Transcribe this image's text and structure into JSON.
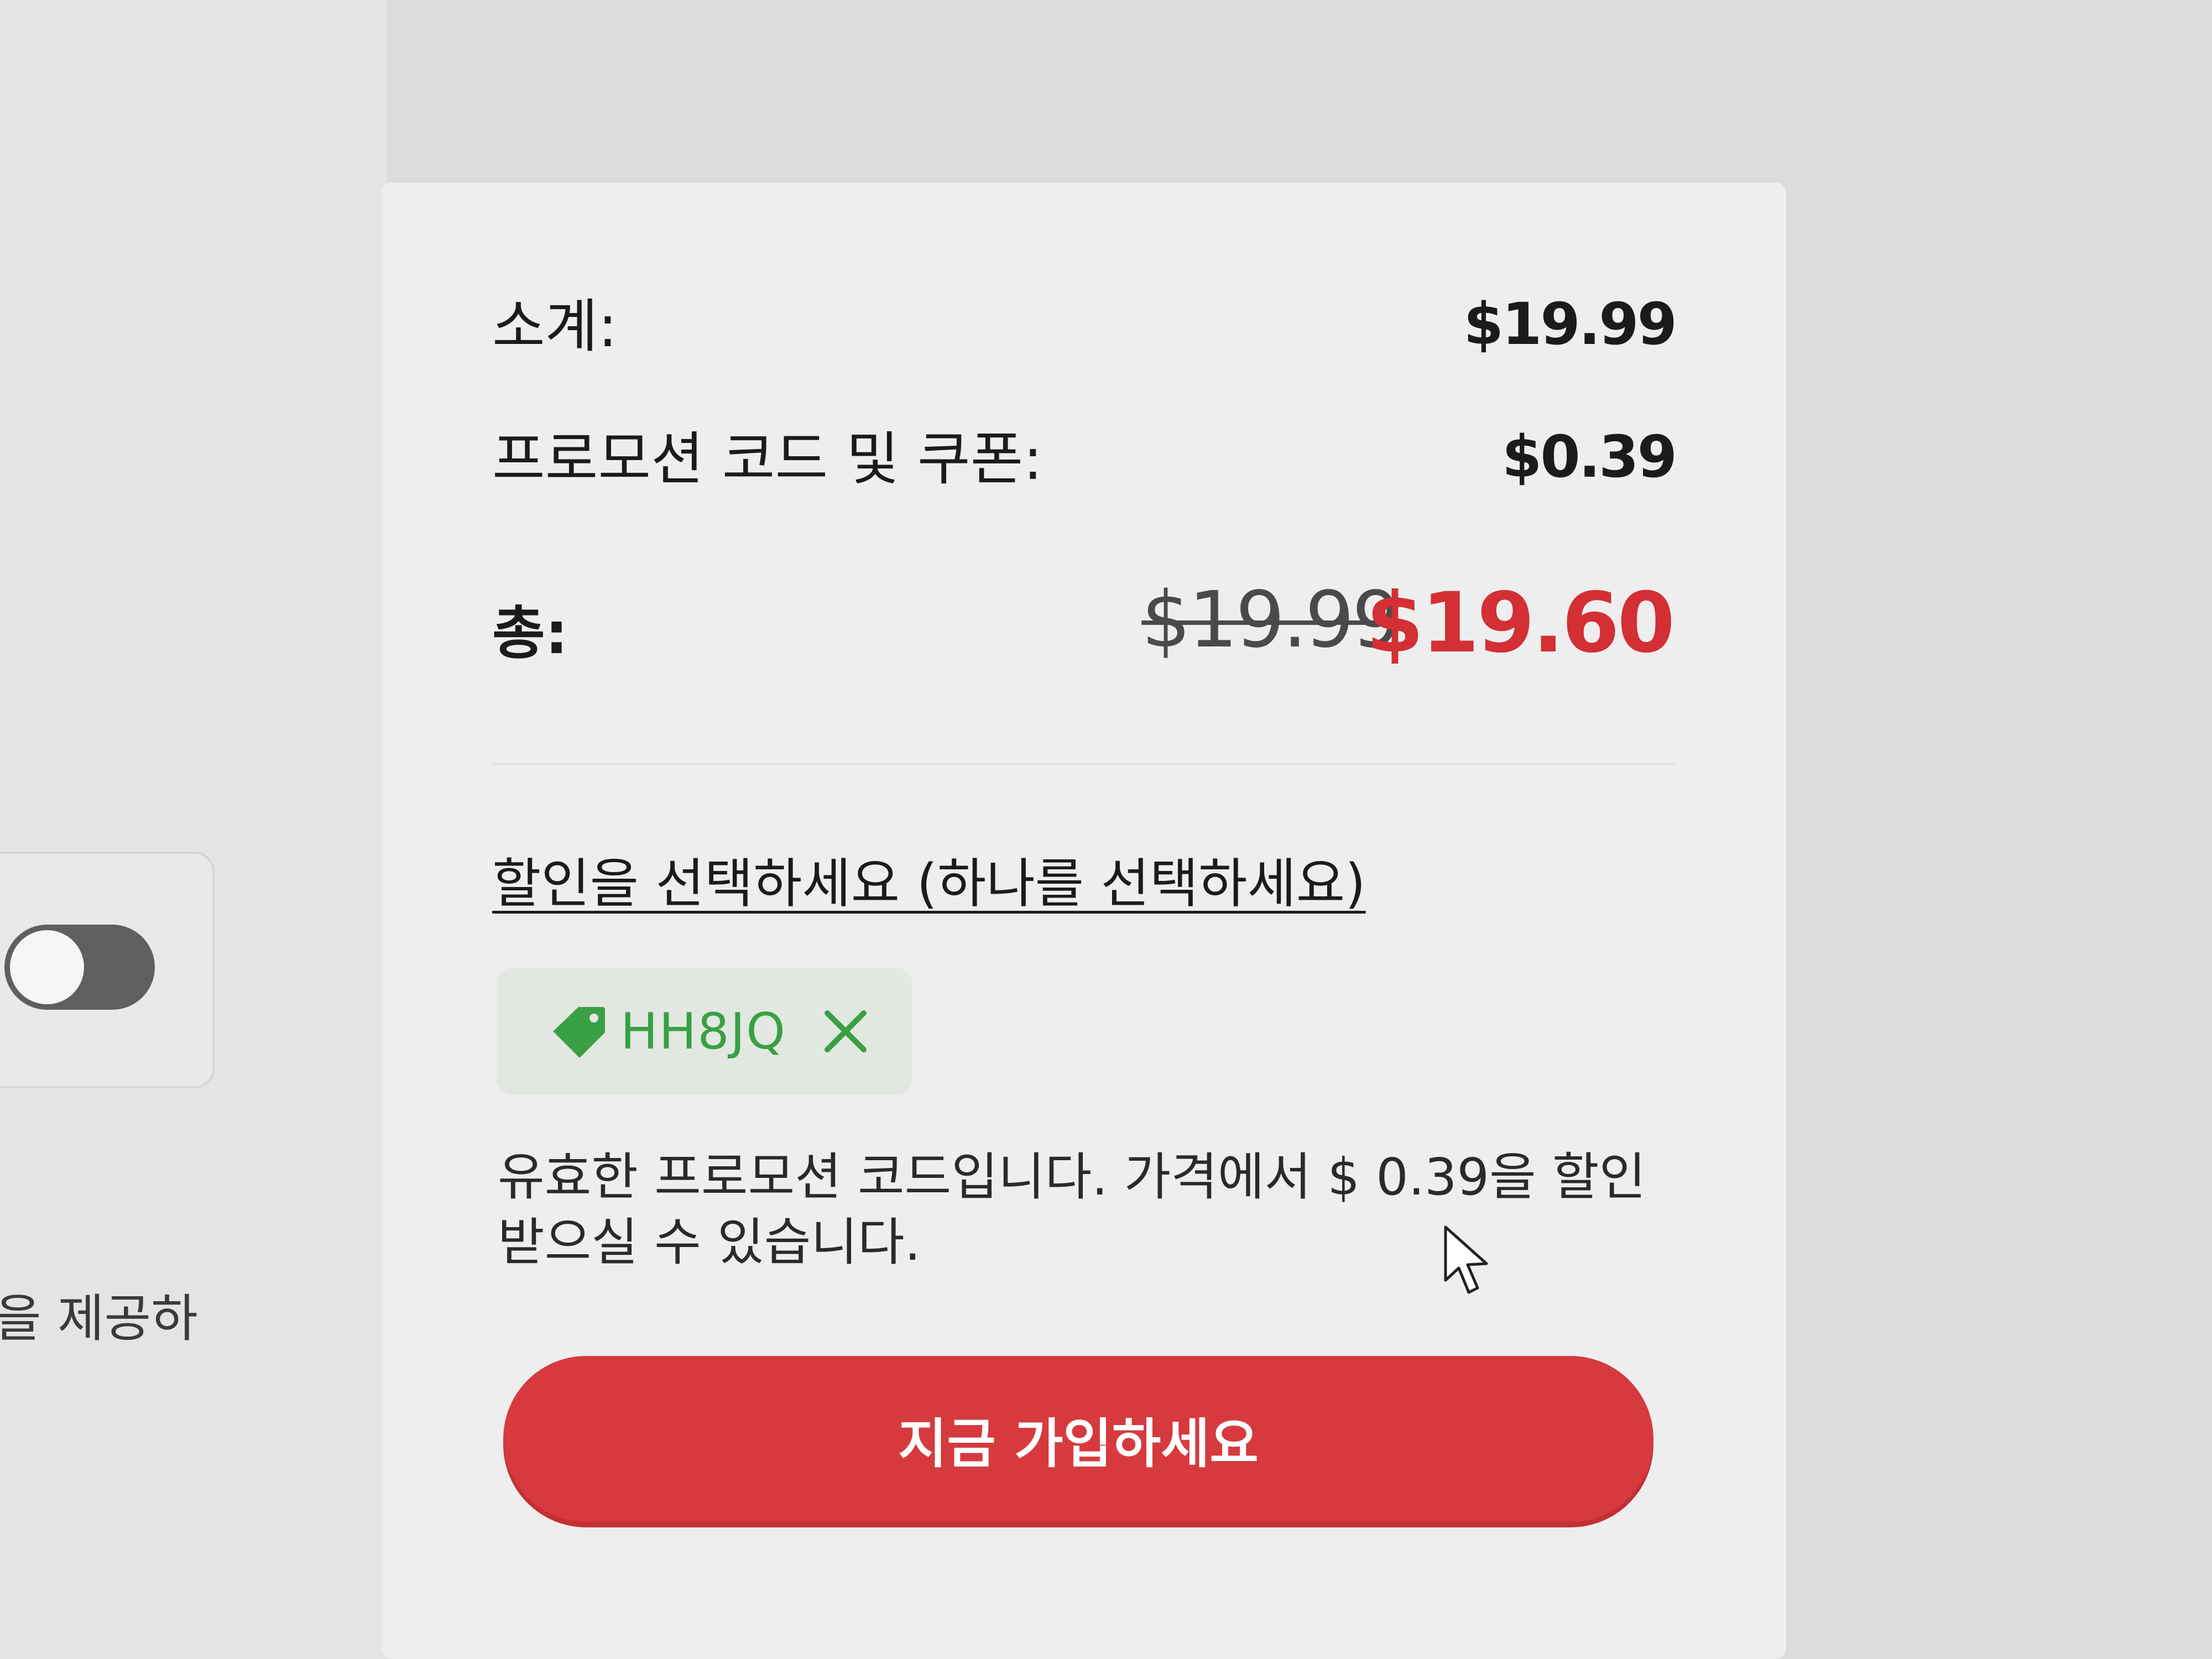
{
  "sidebar": {
    "toggle_state": "off",
    "partial_text": "을 제공하"
  },
  "summary": {
    "subtotal_label": "소계:",
    "subtotal_value": "$19.99",
    "promo_label": "프로모션 코드 및 쿠폰:",
    "promo_value": "$0.39",
    "total_label": "총:",
    "total_original": "$19.99",
    "total_discounted": "$19.60"
  },
  "discount": {
    "select_link": "할인을 선택하세요 (하나를 선택하세요)",
    "applied_code": "HH8JQ",
    "message": "유효한 프로모션 코드입니다. 가격에서 $ 0.39을 할인 받으실 수 있습니다."
  },
  "cta": {
    "label": "지금 가입하세요"
  },
  "colors": {
    "accent_red": "#d63a3e",
    "promo_green": "#39a043"
  },
  "icons": {
    "tag": "tag-icon",
    "remove": "close-icon",
    "cursor": "mouse-pointer-icon"
  }
}
